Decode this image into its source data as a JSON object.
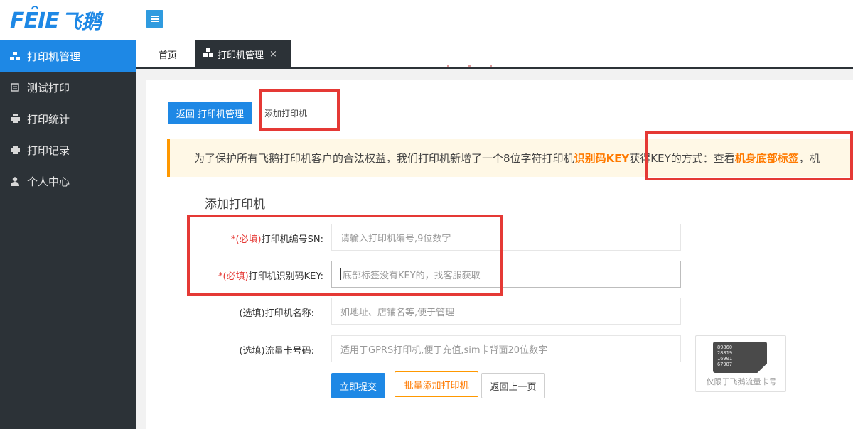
{
  "brand": {
    "logo_latin": "FEIE",
    "logo_cn": "飞鹅"
  },
  "sidebar": {
    "items": [
      {
        "label": "打印机管理",
        "icon": "cubes-icon",
        "active": true
      },
      {
        "label": "测试打印",
        "icon": "document-icon",
        "active": false
      },
      {
        "label": "打印统计",
        "icon": "printer-icon",
        "active": false
      },
      {
        "label": "打印记录",
        "icon": "printer-icon",
        "active": false
      },
      {
        "label": "个人中心",
        "icon": "user-icon",
        "active": false
      }
    ]
  },
  "tabs": {
    "home": "首页",
    "active": "打印机管理",
    "close": "×"
  },
  "page": {
    "back_button": "返回 打印机管理",
    "crumb": "添加打印机"
  },
  "notice": {
    "text_1": "为了保护所有飞鹅打印机客户的合法权益，我们打印机新增了一个8位字符打印机",
    "highlight_1": "识别码KEY",
    "text_2": " 获得KEY的方式：查看",
    "highlight_2": "机身底部标签",
    "text_3": "，机"
  },
  "form": {
    "legend": "添加打印机",
    "fields": [
      {
        "required_tag": "*(必填)",
        "label": "打印机编号SN:",
        "placeholder": "请输入打印机编号,9位数字"
      },
      {
        "required_tag": "*(必填)",
        "label": "打印机识别码KEY:",
        "placeholder": "底部标签没有KEY的，找客服获取"
      },
      {
        "required_tag": "",
        "label": "(选填)打印机名称:",
        "placeholder": "如地址、店铺名等,便于管理"
      },
      {
        "required_tag": "",
        "label": "(选填)流量卡号码:",
        "placeholder": "适用于GPRS打印机,便于充值,sim卡背面20位数字"
      }
    ],
    "sim_card": {
      "numbers": [
        "89860",
        "28819",
        "16901",
        "67987"
      ],
      "caption": "仅限于飞鹅流量卡号"
    },
    "buttons": {
      "submit": "立即提交",
      "batch": "批量添加打印机",
      "prev": "返回上一页"
    }
  },
  "colors": {
    "primary": "#1e88e5",
    "sidebar_bg": "#2c3237",
    "accent_orange": "#ff7a00",
    "required_red": "#e53935",
    "annotation_red": "#e53935"
  }
}
